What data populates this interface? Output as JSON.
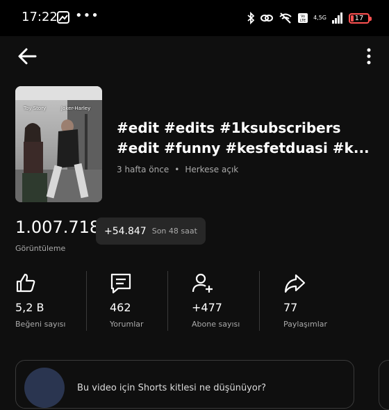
{
  "status_bar": {
    "time": "17:22",
    "dots": "•••",
    "network": "4,5G",
    "battery": "17"
  },
  "video": {
    "thumbnail_labels": [
      "Toy Story",
      "Joker-Harley"
    ],
    "title_line1": "#edit #edits #1ksubscribers",
    "title_line2": "#edit #funny #kesfetduasi #k...",
    "age": "3 hafta önce",
    "separator": "•",
    "visibility": "Herkese açık"
  },
  "views": {
    "count": "1.007.718",
    "label": "Görüntüleme",
    "delta": "+54.847",
    "delta_period": "Son 48 saat"
  },
  "stats": [
    {
      "icon": "thumbs-up-icon",
      "value": "5,2 B",
      "label": "Beğeni sayısı"
    },
    {
      "icon": "comment-icon",
      "value": "462",
      "label": "Yorumlar"
    },
    {
      "icon": "add-person-icon",
      "value": "+477",
      "label": "Abone sayısı"
    },
    {
      "icon": "share-icon",
      "value": "77",
      "label": "Paylaşımlar"
    }
  ],
  "card": {
    "text": "Bu video için Shorts kitlesi ne düşünüyor?"
  },
  "colors": {
    "background": "#0f0f0f",
    "status_bar": "#000000",
    "chip": "#272727",
    "secondary_text": "#aaaaaa",
    "battery_low": "#ff5252"
  }
}
